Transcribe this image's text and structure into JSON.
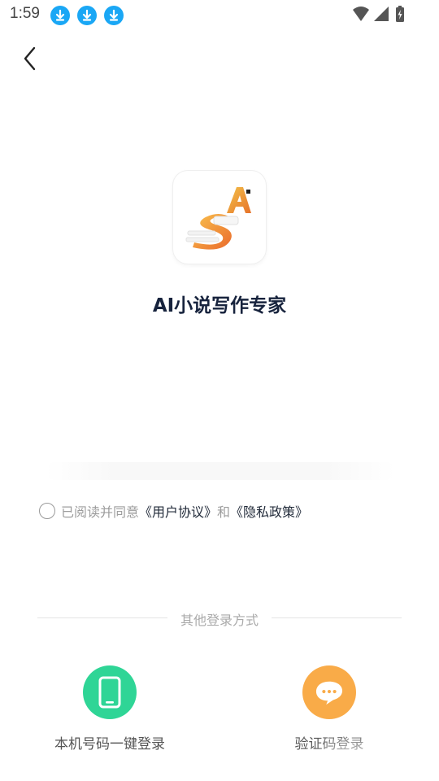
{
  "status_bar": {
    "time": "1:59",
    "download_icons": [
      "download-icon",
      "download-icon",
      "download-icon"
    ],
    "icons": [
      "wifi-icon",
      "signal-icon",
      "battery-icon"
    ]
  },
  "header": {
    "back_icon": "back-arrow-icon"
  },
  "app": {
    "name": "AI小说写作专家"
  },
  "agreement": {
    "prefix": "已阅读并同意",
    "user_agreement": "《用户协议》",
    "and": "和",
    "privacy_policy": "《隐私政策》"
  },
  "other_login": {
    "title": "其他登录方式",
    "options": [
      {
        "label": "本机号码一键登录",
        "icon": "phone-icon",
        "color": "#2fd596"
      },
      {
        "label": "验证码登录",
        "icon": "chat-bubble-icon",
        "color": "#f9ab48"
      }
    ]
  },
  "colors": {
    "accent_blue": "#1aa7f5",
    "title": "#17233d"
  }
}
